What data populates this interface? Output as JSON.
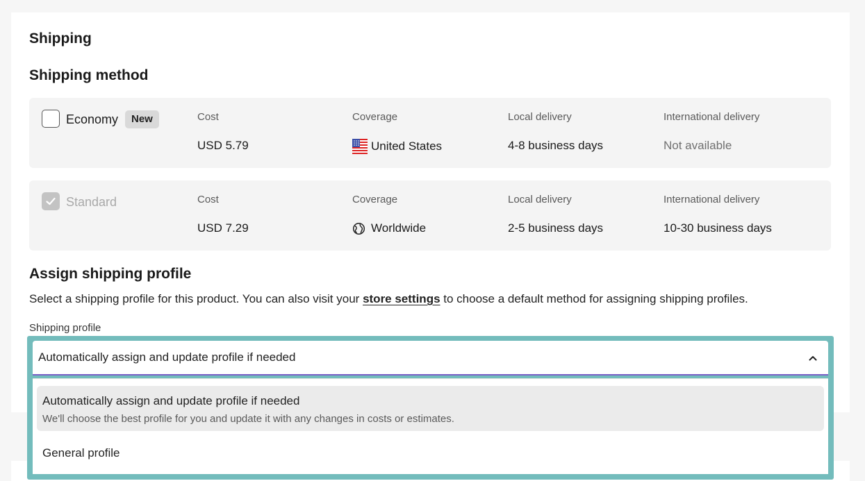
{
  "section_title": "Shipping",
  "method_title": "Shipping method",
  "methods": [
    {
      "name": "Economy",
      "badge": "New",
      "checked": false,
      "cost_label": "Cost",
      "cost": "USD 5.79",
      "coverage_label": "Coverage",
      "coverage": "United States",
      "coverage_icon": "us-flag-icon",
      "local_label": "Local delivery",
      "local": "4-8 business days",
      "intl_label": "International delivery",
      "intl": "Not available"
    },
    {
      "name": "Standard",
      "checked": true,
      "disabled": true,
      "cost_label": "Cost",
      "cost": "USD 7.29",
      "coverage_label": "Coverage",
      "coverage": "Worldwide",
      "coverage_icon": "globe-icon",
      "local_label": "Local delivery",
      "local": "2-5 business days",
      "intl_label": "International delivery",
      "intl": "10-30 business days"
    }
  ],
  "profile": {
    "title": "Assign shipping profile",
    "desc_before": "Select a shipping profile for this product. You can also visit your ",
    "desc_link": "store settings",
    "desc_after": " to choose a default method for assigning shipping profiles.",
    "field_label": "Shipping profile",
    "selected": "Automatically assign and update profile if needed",
    "options": [
      {
        "label": "Automatically assign and update profile if needed",
        "sub": "We'll choose the best profile for you and update it with any changes in costs or estimates.",
        "highlighted": true
      },
      {
        "label": "General profile"
      }
    ]
  },
  "colors": {
    "focus_ring": "#73bcbc",
    "select_underline": "#7a5fc6",
    "method_bg": "#f4f4f4"
  }
}
